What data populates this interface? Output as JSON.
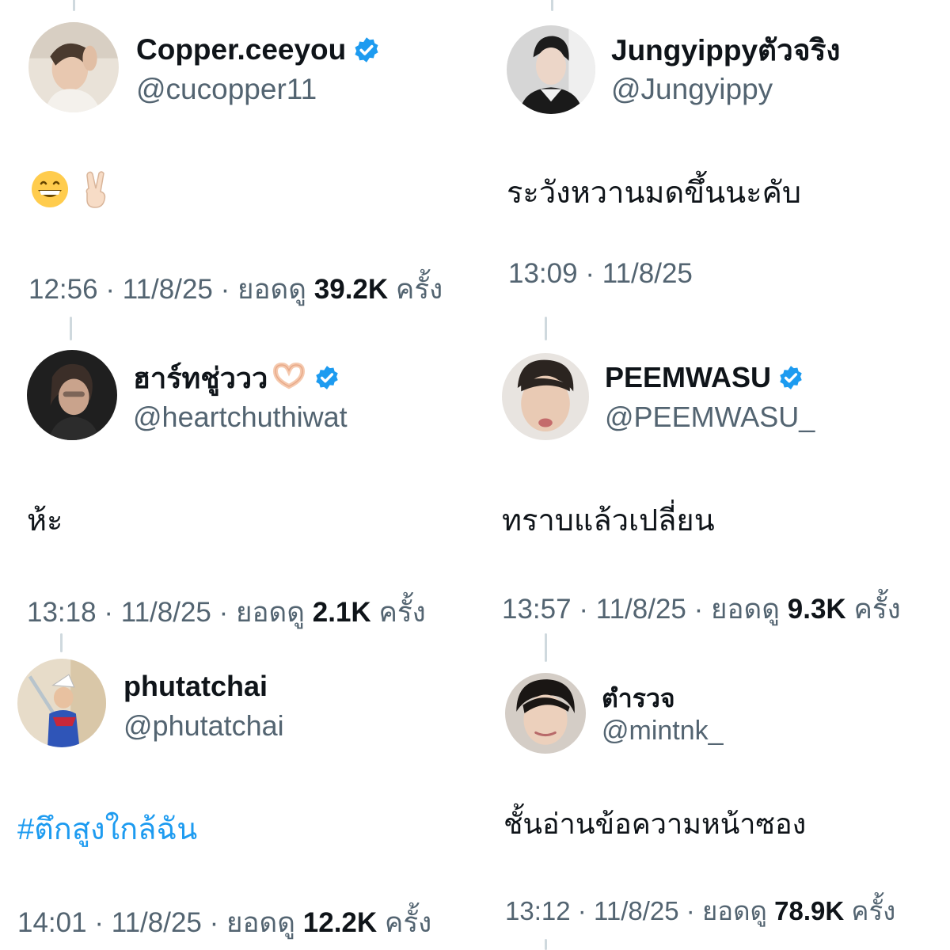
{
  "tweets": [
    {
      "name": "Copper.ceeyou",
      "handle": "@cucopper11",
      "verified": true,
      "body_emoji": [
        "grinning-face",
        "victory-hand"
      ],
      "time": "12:56",
      "date": "11/8/25",
      "views_label": "ยอดดู",
      "views": "39.2K",
      "views_unit": "ครั้ง"
    },
    {
      "name": "Jungyippyตัวจริง",
      "handle": "@Jungyippy",
      "verified": false,
      "body": "ระวังหวานมดขึ้นนะคับ",
      "time": "13:09",
      "date": "11/8/25"
    },
    {
      "name": "ฮาร์ทชู่ววว",
      "name_emoji": "heart-hands",
      "handle": "@heartchuthiwat",
      "verified": true,
      "body": "ห้ะ",
      "time": "13:18",
      "date": "11/8/25",
      "views_label": "ยอดดู",
      "views": "2.1K",
      "views_unit": "ครั้ง"
    },
    {
      "name": "PEEMWASU",
      "handle": "@PEEMWASU_",
      "verified": true,
      "body": "ทราบแล้วเปลี่ยน",
      "time": "13:57",
      "date": "11/8/25",
      "views_label": "ยอดดู",
      "views": "9.3K",
      "views_unit": "ครั้ง"
    },
    {
      "name": "phutatchai",
      "handle": "@phutatchai",
      "verified": false,
      "body": "#ตึกสูงใกล้ฉัน",
      "time": "14:01",
      "date": "11/8/25",
      "views_label": "ยอดดู",
      "views": "12.2K",
      "views_unit": "ครั้ง"
    },
    {
      "name": "ตำรวจ",
      "handle": "@mintnk_",
      "verified": false,
      "body": "ชั้นอ่านข้อความหน้าซอง",
      "time": "13:12",
      "date": "11/8/25",
      "views_label": "ยอดดู",
      "views": "78.9K",
      "views_unit": "ครั้ง"
    }
  ],
  "meta_separator": "·",
  "colors": {
    "text": "#0f1419",
    "secondary": "#536471",
    "verified": "#1d9bf0",
    "hashtag": "#1d9bf0",
    "thread_line": "#cfd9de"
  },
  "icons": {
    "verified": "verified-badge-icon"
  }
}
